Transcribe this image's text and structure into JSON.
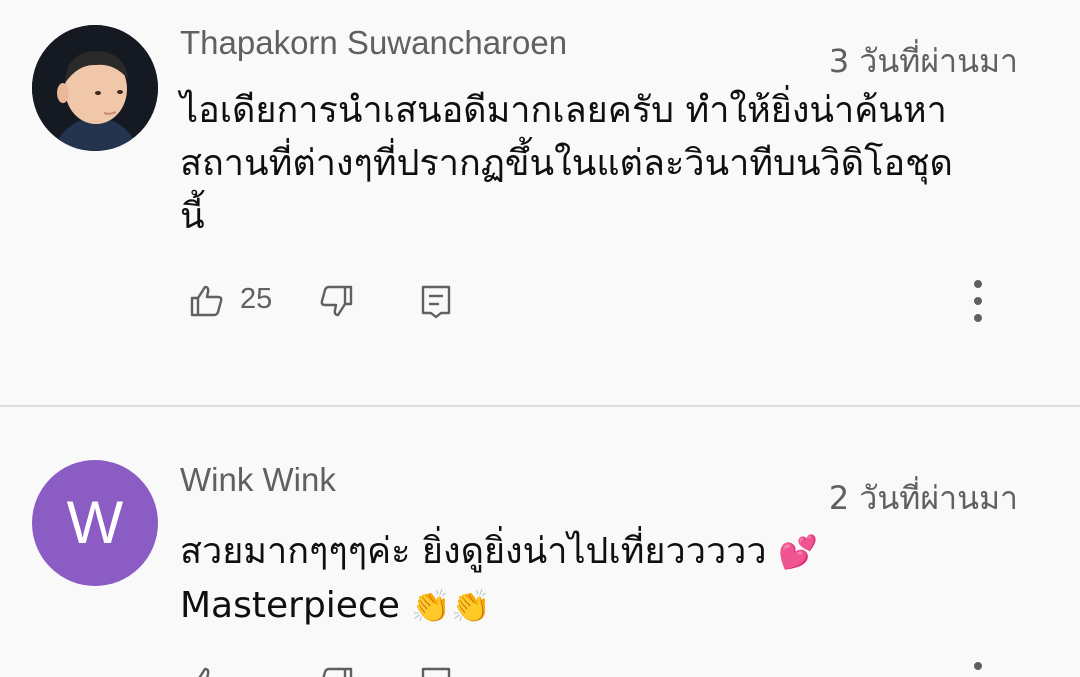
{
  "comments": [
    {
      "author": "Thapakorn Suwancharoen",
      "time": "3 วันที่ผ่านมา",
      "text_lines": [
        "ไอเดียการนำเสนอดีมากเลยครับ ทำให้ยิ่งน่าค้นหา",
        "สถานที่ต่างๆที่ปรากฏขึ้นในแต่ละวินาทีบนวิดิโอชุด",
        "นี้"
      ],
      "likes": "25",
      "avatar_type": "photo"
    },
    {
      "author": "Wink Wink",
      "time": "2 วันที่ผ่านมา",
      "avatar_letter": "W",
      "avatar_color": "#8a5cc4",
      "text_line1": "สวยมากๆๆๆค่ะ ยิ่งดูยิ่งน่าไปเที่ยววววว",
      "text_line1_emoji": "💕",
      "text_line2": "Masterpiece",
      "text_line2_emoji": "👏👏"
    }
  ],
  "icons": {
    "like": "thumbs-up-icon",
    "dislike": "thumbs-down-icon",
    "reply": "reply-comment-icon",
    "more": "more-vertical-icon"
  },
  "colors": {
    "background": "#f9f9f9",
    "secondary_text": "#606060",
    "primary_text": "#0f0f0f",
    "divider": "#dcdcdc"
  }
}
